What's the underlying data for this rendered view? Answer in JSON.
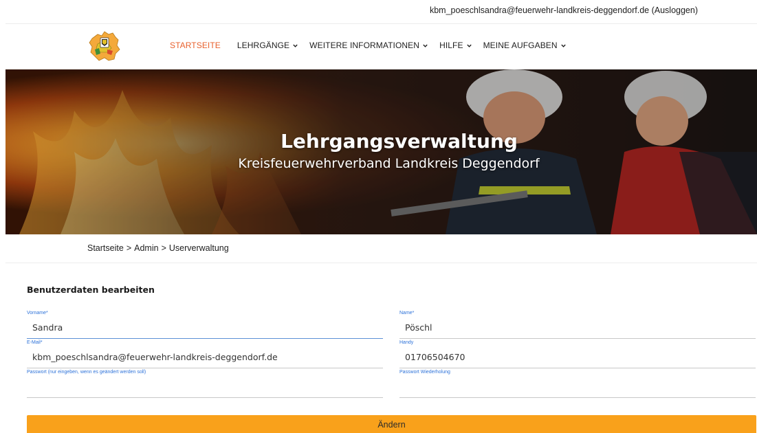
{
  "header": {
    "user_email": "kbm_poeschlsandra@feuerwehr-landkreis-deggendorf.de",
    "logout_label": "(Ausloggen)"
  },
  "nav": {
    "items": [
      {
        "label": "STARTSEITE",
        "active": true,
        "has_dropdown": false
      },
      {
        "label": "LEHRGÄNGE",
        "active": false,
        "has_dropdown": true
      },
      {
        "label": "WEITERE INFORMATIONEN",
        "active": false,
        "has_dropdown": true
      },
      {
        "label": "HILFE",
        "active": false,
        "has_dropdown": true
      },
      {
        "label": "MEINE AUFGABEN",
        "active": false,
        "has_dropdown": true
      }
    ],
    "active_color": "#e8602c"
  },
  "hero": {
    "title": "Lehrgangsverwaltung",
    "subtitle": "Kreisfeuerwehrverband Landkreis Deggendorf"
  },
  "breadcrumb": {
    "items": [
      "Startseite",
      "Admin",
      "Userverwaltung"
    ],
    "separator": ">"
  },
  "form": {
    "title": "Benutzerdaten bearbeiten",
    "fields": {
      "vorname": {
        "label": "Vorname*",
        "value": "Sandra"
      },
      "name": {
        "label": "Name*",
        "value": "Pöschl"
      },
      "email": {
        "label": "E-Mail*",
        "value": "kbm_poeschlsandra@feuerwehr-landkreis-deggendorf.de"
      },
      "handy": {
        "label": "Handy",
        "value": "01706504670"
      },
      "passwort": {
        "label": "Passwort (nur eingeben, wenn es geändert werden soll)",
        "value": ""
      },
      "passwort_wdh": {
        "label": "Passwort Wiederholung",
        "value": ""
      }
    },
    "submit_label": "Ändern"
  },
  "colors": {
    "accent": "#f9a11b",
    "label_blue": "#2d72d9"
  }
}
